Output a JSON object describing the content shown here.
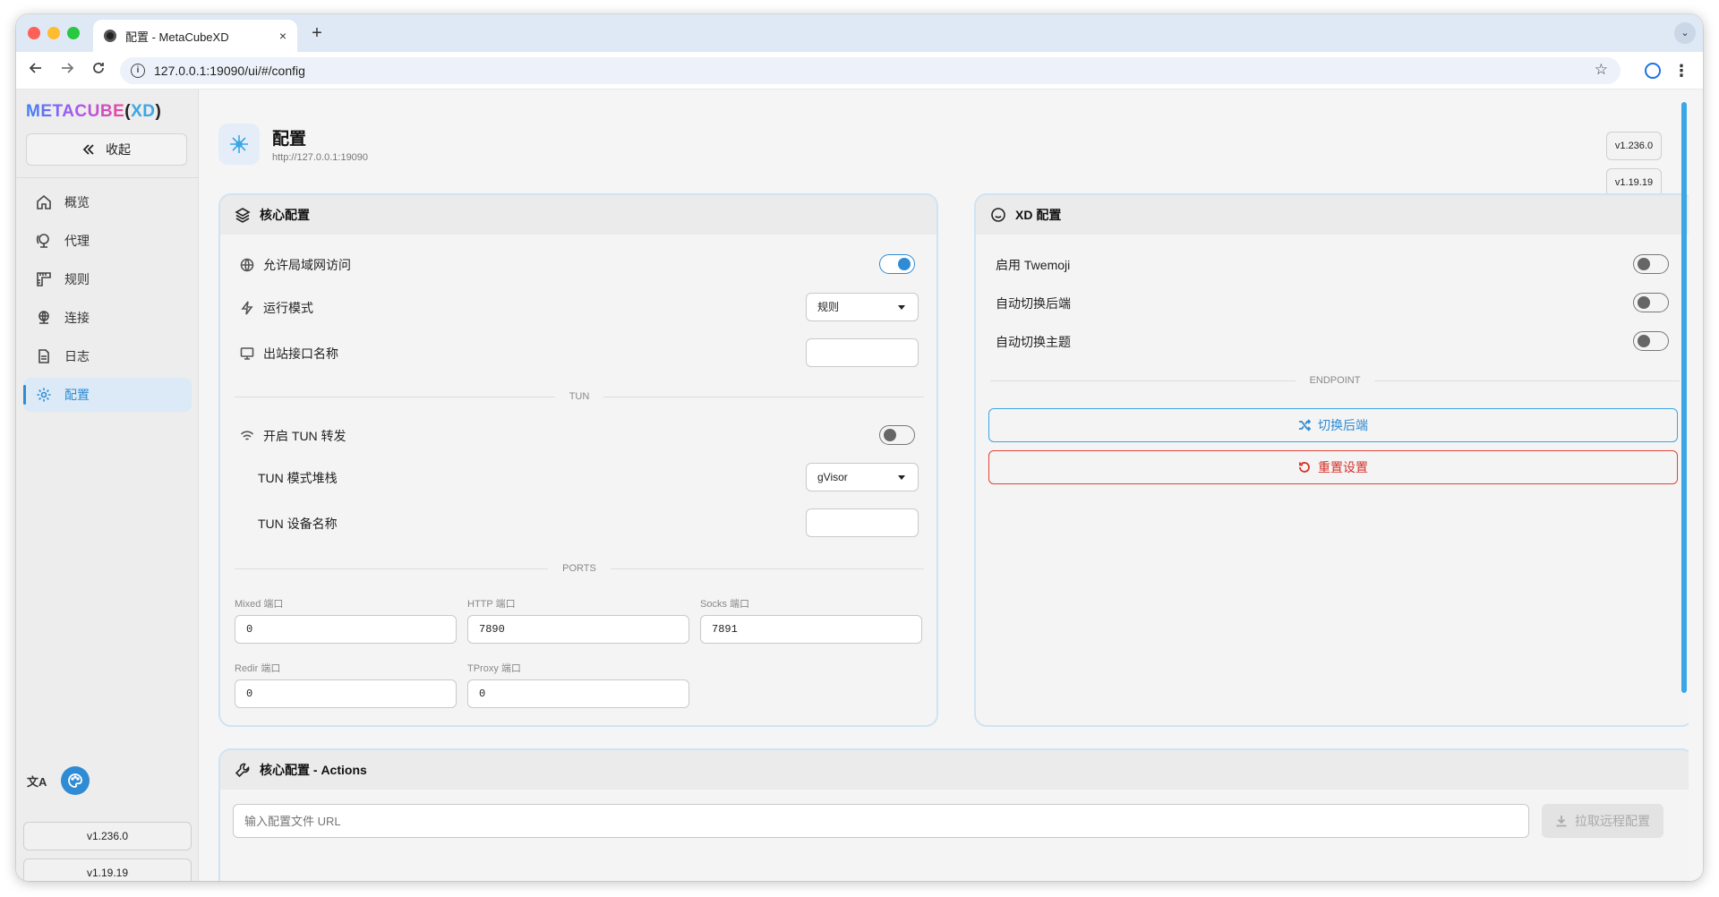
{
  "browser": {
    "tab_title": "配置 - MetaCubeXD",
    "tab_close": "×",
    "new_tab": "+",
    "url": "127.0.0.1:19090/ui/#/config",
    "info_glyph": "i",
    "strip_menu_glyph": "⌄"
  },
  "sidebar": {
    "logo_brand": "METACUBE",
    "logo_open": "(",
    "logo_xd": "XD",
    "logo_close": ")",
    "collapse_label": "收起",
    "translate_glyph": "文A",
    "items": [
      {
        "label": "概览",
        "icon": "home-icon"
      },
      {
        "label": "代理",
        "icon": "globe-stand-icon"
      },
      {
        "label": "规则",
        "icon": "ruler-icon"
      },
      {
        "label": "连接",
        "icon": "network-icon"
      },
      {
        "label": "日志",
        "icon": "file-icon"
      },
      {
        "label": "配置",
        "icon": "gear-icon"
      }
    ],
    "version_ui": "v1.236.0",
    "version_core": "v1.19.19"
  },
  "page": {
    "title": "配置",
    "subtitle": "http://127.0.0.1:19090",
    "version_ui": "v1.236.0",
    "version_core": "v1.19.19"
  },
  "core_config": {
    "title": "核心配置",
    "allow_lan": {
      "label": "允许局域网访问",
      "on": true
    },
    "mode": {
      "label": "运行模式",
      "value": "规则"
    },
    "interface": {
      "label": "出站接口名称",
      "value": ""
    },
    "tun_divider": "TUN",
    "tun_enable": {
      "label": "开启 TUN 转发",
      "on": false
    },
    "tun_stack": {
      "label": "TUN 模式堆栈",
      "value": "gVisor"
    },
    "tun_device": {
      "label": "TUN 设备名称",
      "value": ""
    },
    "ports_divider": "PORTS",
    "ports": {
      "mixed": {
        "label": "Mixed 端口",
        "value": "0"
      },
      "http": {
        "label": "HTTP 端口",
        "value": "7890"
      },
      "socks": {
        "label": "Socks 端口",
        "value": "7891"
      },
      "redir": {
        "label": "Redir 端口",
        "value": "0"
      },
      "tproxy": {
        "label": "TProxy 端口",
        "value": "0"
      }
    }
  },
  "xd_config": {
    "title": "XD 配置",
    "twemoji": {
      "label": "启用 Twemoji",
      "on": false
    },
    "auto_switch_backend": {
      "label": "自动切换后端",
      "on": false
    },
    "auto_switch_theme": {
      "label": "自动切换主题",
      "on": false
    },
    "endpoint_divider": "ENDPOINT",
    "switch_backend_label": "切换后端",
    "reset_label": "重置设置"
  },
  "actions": {
    "title": "核心配置 - Actions",
    "url_placeholder": "输入配置文件 URL",
    "pull_label": "拉取远程配置"
  },
  "colors": {
    "accent": "#2f8bd4",
    "danger": "#d6312b",
    "card_border": "#cfe3f3"
  }
}
